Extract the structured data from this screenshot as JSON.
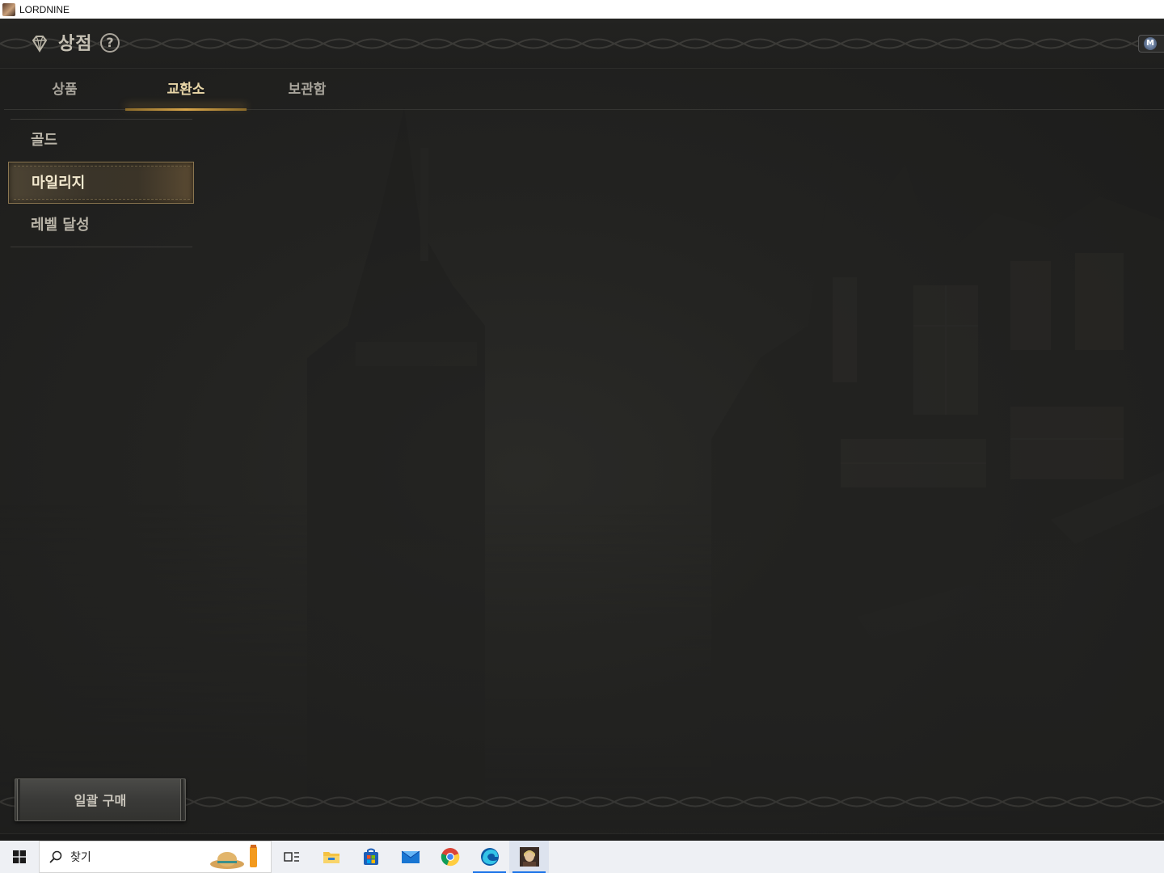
{
  "window": {
    "title": "LORDNINE"
  },
  "header": {
    "title": "상점",
    "help_icon": "question-icon",
    "gem_icon": "diamond-icon"
  },
  "tabs": [
    {
      "label": "상품",
      "active": false
    },
    {
      "label": "교환소",
      "active": true
    },
    {
      "label": "보관함",
      "active": false
    }
  ],
  "categories": [
    {
      "label": "골드",
      "active": false
    },
    {
      "label": "마일리지",
      "active": true
    },
    {
      "label": "레벨 달성",
      "active": false
    }
  ],
  "bulk_buy": {
    "label": "일괄 구매"
  },
  "taskbar": {
    "search_placeholder": "찾기",
    "apps": [
      "task-view",
      "file-explorer",
      "microsoft-store",
      "mail",
      "chrome",
      "edge",
      "lordnine"
    ]
  },
  "colors": {
    "accent_gold": "#d9a64a",
    "active_tab_text": "#e9d7a8",
    "bg": "#1d1d1c"
  }
}
